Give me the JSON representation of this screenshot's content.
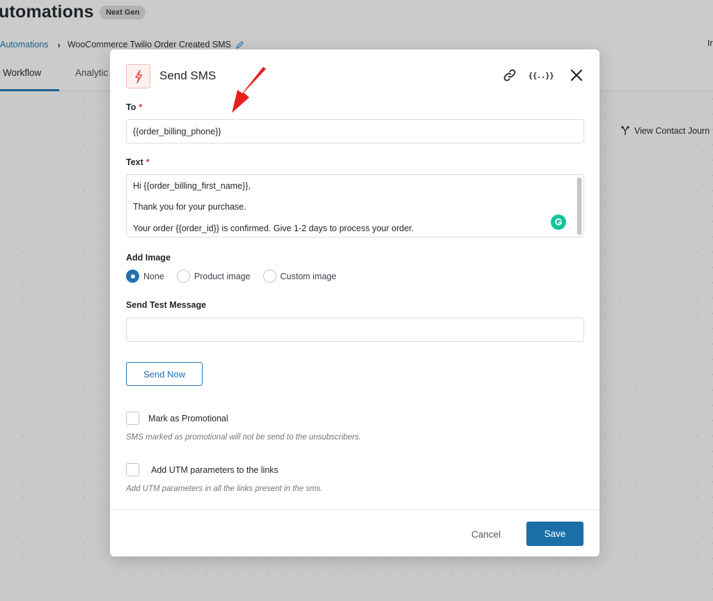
{
  "page": {
    "title": "utomations",
    "badge": "Next Gen",
    "breadcrumb": {
      "link": "Automations",
      "current": "WooCommerce Twilio Order Created SMS"
    },
    "top_right_fragment": "Ir",
    "tabs": [
      {
        "label": "Workflow",
        "active": true
      },
      {
        "label": "Analytic",
        "active": false
      }
    ],
    "view_journey": "View Contact Journ"
  },
  "modal": {
    "title": "Send SMS",
    "icons": {
      "action": "bolt-icon",
      "link": "link-icon",
      "merge_tags": "{{..}}",
      "close": "close-icon"
    },
    "to": {
      "label": "To",
      "required": "*",
      "value": "{{order_billing_phone}}"
    },
    "text": {
      "label": "Text",
      "required": "*",
      "lines": [
        "Hi {{order_billing_first_name}},",
        "Thank you for your purchase.",
        "Your order {{order_id}} is confirmed. Give 1-2 days to process your order."
      ]
    },
    "add_image": {
      "label": "Add Image",
      "options": [
        "None",
        "Product image",
        "Custom image"
      ],
      "selected": "None"
    },
    "send_test": {
      "label": "Send Test Message",
      "value": "",
      "button": "Send Now"
    },
    "promotional": {
      "label": "Mark as Promotional",
      "checked": false,
      "help": "SMS marked as promotional will not be send to the unsubscribers."
    },
    "utm": {
      "label": "Add UTM parameters to the links",
      "checked": false,
      "help": "Add UTM parameters in all the links present in the sms."
    },
    "footer": {
      "cancel": "Cancel",
      "save": "Save"
    }
  },
  "colors": {
    "accent": "#2271b1",
    "save_button": "#1a6fa8",
    "required": "#d63638",
    "annotation_arrow": "#e8201d",
    "grammarly": "#15c39a"
  }
}
